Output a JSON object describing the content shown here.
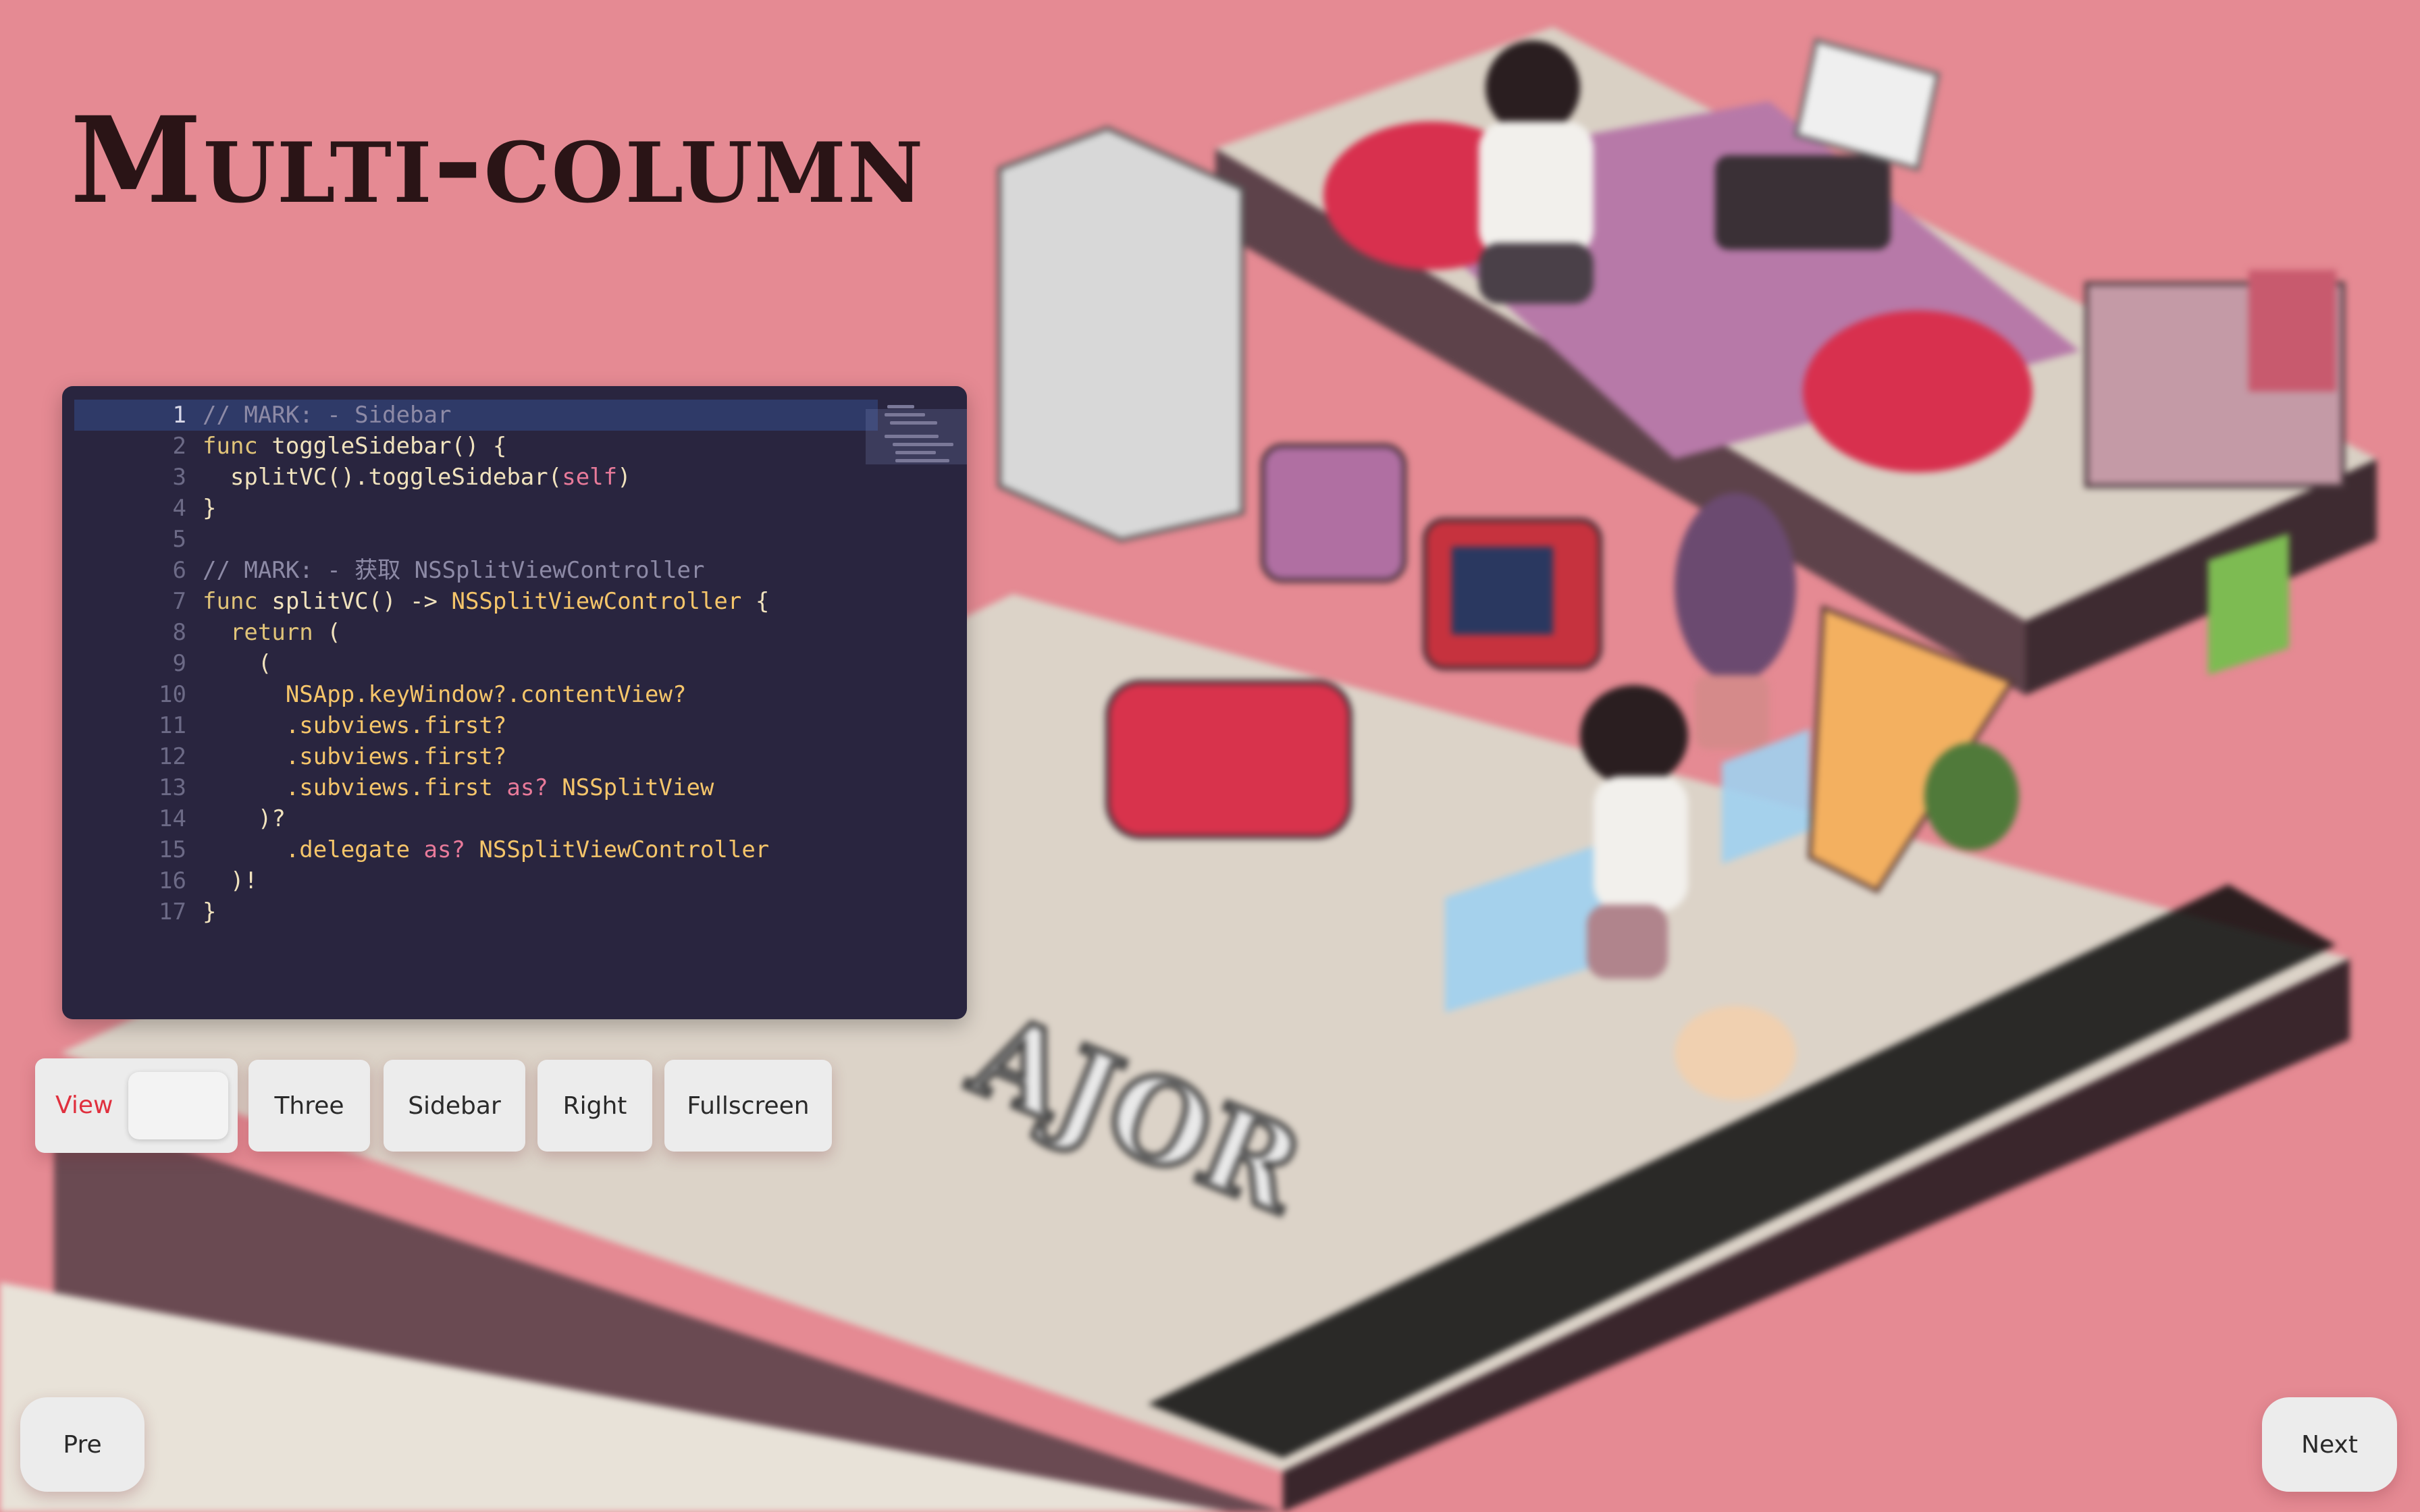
{
  "title": "Multi-column",
  "code": {
    "active_line": 1,
    "lines": [
      {
        "n": "1",
        "segments": [
          {
            "t": "// MARK: - Sidebar",
            "c": "#8d8aa6"
          }
        ]
      },
      {
        "n": "2",
        "segments": [
          {
            "t": "func ",
            "c": "#e0c378"
          },
          {
            "t": "toggleSidebar() {",
            "c": "#f0e2bd"
          }
        ]
      },
      {
        "n": "3",
        "segments": [
          {
            "t": "  splitVC().toggleSidebar(",
            "c": "#f0e2bd"
          },
          {
            "t": "self",
            "c": "#e87a9a"
          },
          {
            "t": ")",
            "c": "#f0e2bd"
          }
        ]
      },
      {
        "n": "4",
        "segments": [
          {
            "t": "}",
            "c": "#f0e2bd"
          }
        ]
      },
      {
        "n": "5",
        "segments": [
          {
            "t": "",
            "c": "#f0e2bd"
          }
        ]
      },
      {
        "n": "6",
        "segments": [
          {
            "t": "// MARK: - 获取 NSSplitViewController",
            "c": "#8d8aa6"
          }
        ]
      },
      {
        "n": "7",
        "segments": [
          {
            "t": "func ",
            "c": "#e0c378"
          },
          {
            "t": "splitVC() -> ",
            "c": "#f0e2bd"
          },
          {
            "t": "NSSplitViewController",
            "c": "#f5c56a"
          },
          {
            "t": " {",
            "c": "#f0e2bd"
          }
        ]
      },
      {
        "n": "8",
        "segments": [
          {
            "t": "  return",
            "c": "#e0c378"
          },
          {
            "t": " (",
            "c": "#f0e2bd"
          }
        ]
      },
      {
        "n": "9",
        "segments": [
          {
            "t": "    (",
            "c": "#f0e2bd"
          }
        ]
      },
      {
        "n": "10",
        "segments": [
          {
            "t": "      NSApp.keyWindow?.contentView?",
            "c": "#f5c56a"
          }
        ]
      },
      {
        "n": "11",
        "segments": [
          {
            "t": "      .subviews.first?",
            "c": "#f5c56a"
          }
        ]
      },
      {
        "n": "12",
        "segments": [
          {
            "t": "      .subviews.first?",
            "c": "#f5c56a"
          }
        ]
      },
      {
        "n": "13",
        "segments": [
          {
            "t": "      .subviews.first ",
            "c": "#f5c56a"
          },
          {
            "t": "as?",
            "c": "#e87a9a"
          },
          {
            "t": " NSSplitView",
            "c": "#f5c56a"
          }
        ]
      },
      {
        "n": "14",
        "segments": [
          {
            "t": "    )?",
            "c": "#f0e2bd"
          }
        ]
      },
      {
        "n": "15",
        "segments": [
          {
            "t": "      .delegate ",
            "c": "#f5c56a"
          },
          {
            "t": "as?",
            "c": "#e87a9a"
          },
          {
            "t": " NSSplitViewController",
            "c": "#f5c56a"
          }
        ]
      },
      {
        "n": "16",
        "segments": [
          {
            "t": "  )!",
            "c": "#f0e2bd"
          }
        ]
      },
      {
        "n": "17",
        "segments": [
          {
            "t": "}",
            "c": "#f0e2bd"
          }
        ]
      }
    ]
  },
  "controls": {
    "view_label": "View",
    "three_label": "Three",
    "sidebar_label": "Sidebar",
    "right_label": "Right",
    "fullscreen_label": "Fullscreen"
  },
  "nav": {
    "pre_label": "Pre",
    "next_label": "Next"
  },
  "scene_text": "AJOR",
  "colors": {
    "background": "#e58a93",
    "editor_bg": "#29253f",
    "accent_red": "#e0303e"
  }
}
